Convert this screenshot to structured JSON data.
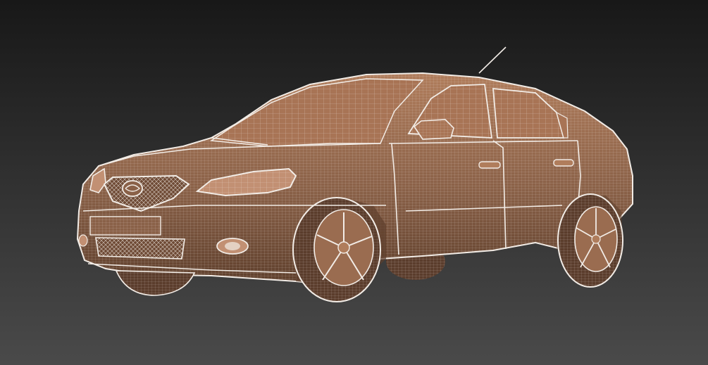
{
  "scene": {
    "subject": "sedan-car-wireframe-render",
    "colors": {
      "background_top": "#181818",
      "background_bottom": "#4a4a4a",
      "body_fill": "#8a6148",
      "body_fill_light": "#b07d5c",
      "body_fill_dark": "#5e3f2c",
      "wire": "#f2ece6",
      "glass": "#a87455",
      "tire": "#5b3d2c",
      "rim": "#9a6c50"
    }
  }
}
